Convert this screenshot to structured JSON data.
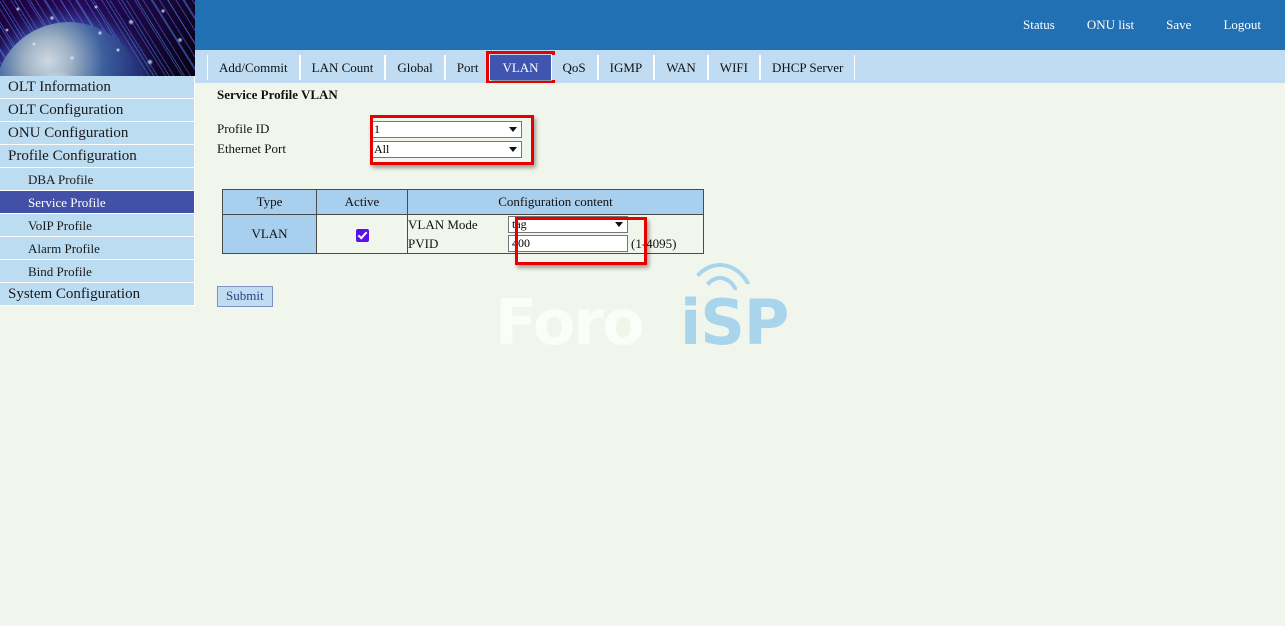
{
  "header": {
    "menu": [
      {
        "label": "Status",
        "name": "topmenu-status"
      },
      {
        "label": "ONU list",
        "name": "topmenu-onu-list"
      },
      {
        "label": "Save",
        "name": "topmenu-save"
      },
      {
        "label": "Logout",
        "name": "topmenu-logout"
      }
    ],
    "bar_color": "#2170b4"
  },
  "sidebar": {
    "items": [
      {
        "label": "OLT Information",
        "level": 0,
        "active": false
      },
      {
        "label": "OLT Configuration",
        "level": 0,
        "active": false
      },
      {
        "label": "ONU Configuration",
        "level": 0,
        "active": false
      },
      {
        "label": "Profile Configuration",
        "level": 0,
        "active": false
      },
      {
        "label": "DBA Profile",
        "level": 1,
        "active": false
      },
      {
        "label": "Service Profile",
        "level": 1,
        "active": true
      },
      {
        "label": "VoIP Profile",
        "level": 1,
        "active": false
      },
      {
        "label": "Alarm Profile",
        "level": 1,
        "active": false
      },
      {
        "label": "Bind Profile",
        "level": 1,
        "active": false
      },
      {
        "label": "System Configuration",
        "level": 0,
        "active": false
      }
    ],
    "active_color": "#4350a8",
    "item_color": "#bcdcf2"
  },
  "tabs": {
    "items": [
      {
        "label": "Add/Commit",
        "active": false,
        "highlight": false
      },
      {
        "label": "LAN Count",
        "active": false,
        "highlight": false
      },
      {
        "label": "Global",
        "active": false,
        "highlight": false
      },
      {
        "label": "Port",
        "active": false,
        "highlight": false
      },
      {
        "label": "VLAN",
        "active": true,
        "highlight": true
      },
      {
        "label": "QoS",
        "active": false,
        "highlight": false
      },
      {
        "label": "IGMP",
        "active": false,
        "highlight": false
      },
      {
        "label": "WAN",
        "active": false,
        "highlight": false
      },
      {
        "label": "WIFI",
        "active": false,
        "highlight": false
      },
      {
        "label": "DHCP Server",
        "active": false,
        "highlight": false
      }
    ],
    "active_color": "#4055b0",
    "highlight_color": "#e60000"
  },
  "main": {
    "title": "Service Profile VLAN",
    "form": {
      "profile_id": {
        "label": "Profile ID",
        "value": "1"
      },
      "ethernet_port": {
        "label": "Ethernet Port",
        "value": "All"
      }
    },
    "table": {
      "headers": [
        "Type",
        "Active",
        "Configuration content"
      ],
      "row": {
        "type": "VLAN",
        "active": true,
        "config": {
          "vlan_mode_label": "VLAN Mode",
          "vlan_mode_value": "tag",
          "pvid_label": "PVID",
          "pvid_value": "400",
          "pvid_hint": "(1-4095)"
        }
      }
    },
    "submit_label": "Submit"
  },
  "watermark": {
    "text_light": "Foro",
    "text_accent": "iSP",
    "accent_color": "#a8d4ec"
  }
}
